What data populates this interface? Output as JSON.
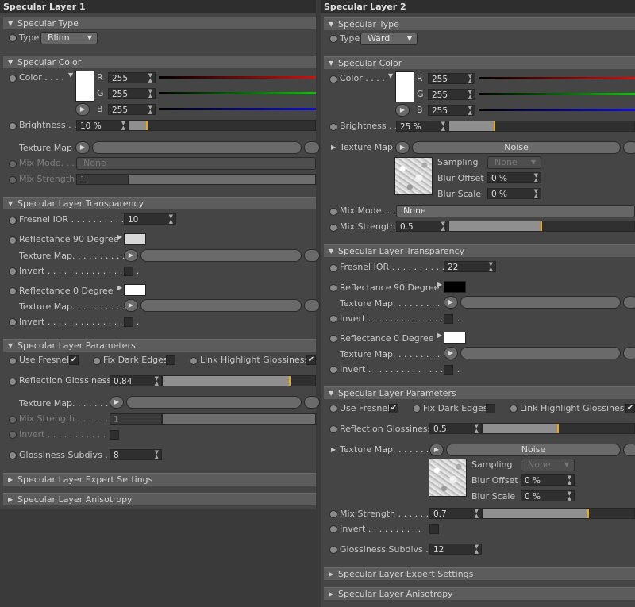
{
  "layer1": {
    "title": "Specular Layer 1",
    "spec_type": {
      "header": "Specular Type",
      "type_label": "Type",
      "type_value": "Blinn"
    },
    "spec_color": {
      "header": "Specular Color",
      "color_label": "Color . . . .",
      "r_label": "R",
      "r_value": "255",
      "g_label": "G",
      "g_value": "255",
      "b_label": "B",
      "b_value": "255",
      "brightness_label": "Brightness . .",
      "brightness_value": "10 %",
      "brightness_fraction": 0.1,
      "texture_label": "Texture Map",
      "mix_mode_label": "Mix Mode. . . .",
      "mix_mode_value": "None",
      "mix_strength_label": "Mix Strength",
      "mix_strength_value": "1",
      "mix_strength_fraction": 1.0
    },
    "transparency": {
      "header": "Specular Layer Transparency",
      "fresnel_label": "Fresnel IOR . . . . . . . . . . . .",
      "fresnel_value": "10",
      "refl90_label": "Reflectance 90 Degree",
      "texture_label": "Texture Map. . . . . . . . . . .",
      "invert_label": "Invert . . . . . . . . . . . . . . . . .",
      "refl0_label": "Reflectance  0 Degree",
      "texture2_label": "Texture Map. . . . . . . . . . .",
      "invert2_label": "Invert . . . . . . . . . . . . . . . . ."
    },
    "params": {
      "header": "Specular Layer Parameters",
      "use_fresnel_label": "Use Fresnel",
      "fix_dark_label": "Fix Dark Edges",
      "link_label": "Link Highlight Glossiness",
      "refl_gloss_label": "Reflection Glossiness",
      "refl_gloss_value": "0.84",
      "refl_gloss_fraction": 0.84,
      "texture_label": "Texture Map. . . . . . . .",
      "mix_strength_label": "Mix Strength . . . . . . .",
      "mix_strength_value": "1",
      "mix_strength_fraction": 1.0,
      "invert_label": "Invert . . . . . . . . . . . . .",
      "subdivs_label": "Glossiness Subdivs . .",
      "subdivs_value": "8"
    },
    "expert": "Specular Layer Expert Settings",
    "aniso": "Specular Layer Anisotropy"
  },
  "layer2": {
    "title": "Specular Layer 2",
    "spec_type": {
      "header": "Specular Type",
      "type_label": "Type",
      "type_value": "Ward"
    },
    "spec_color": {
      "header": "Specular Color",
      "color_label": "Color . . . .",
      "r_label": "R",
      "r_value": "255",
      "g_label": "G",
      "g_value": "255",
      "b_label": "B",
      "b_value": "255",
      "brightness_label": "Brightness . .",
      "brightness_value": "25 %",
      "brightness_fraction": 0.25,
      "texture_label": "Texture Map",
      "texture_shader": "Noise",
      "sampling_label": "Sampling",
      "sampling_value": "None",
      "blur_offset_label": "Blur Offset",
      "blur_offset_value": "0 %",
      "blur_scale_label": "Blur Scale",
      "blur_scale_value": "0 %",
      "mix_mode_label": "Mix Mode. . . .",
      "mix_mode_value": "None",
      "mix_strength_label": "Mix Strength",
      "mix_strength_value": "0.5",
      "mix_strength_fraction": 0.5
    },
    "transparency": {
      "header": "Specular Layer Transparency",
      "fresnel_label": "Fresnel IOR . . . . . . . . . . . .",
      "fresnel_value": "22",
      "refl90_label": "Reflectance 90 Degree",
      "texture_label": "Texture Map. . . . . . . . . . .",
      "invert_label": "Invert . . . . . . . . . . . . . . . . .",
      "refl0_label": "Reflectance  0 Degree",
      "texture2_label": "Texture Map. . . . . . . . . . .",
      "invert2_label": "Invert . . . . . . . . . . . . . . . . ."
    },
    "params": {
      "header": "Specular Layer Parameters",
      "use_fresnel_label": "Use Fresnel",
      "fix_dark_label": "Fix Dark Edges",
      "link_label": "Link Highlight Glossiness",
      "refl_gloss_label": "Reflection Glossiness",
      "refl_gloss_value": "0.5",
      "refl_gloss_fraction": 0.5,
      "texture_label": "Texture Map. . . . . . . .",
      "texture_shader": "Noise",
      "sampling_label": "Sampling",
      "sampling_value": "None",
      "blur_offset_label": "Blur Offset",
      "blur_offset_value": "0 %",
      "blur_scale_label": "Blur Scale",
      "blur_scale_value": "0 %",
      "mix_strength_label": "Mix Strength . . . . . . .",
      "mix_strength_value": "0.7",
      "mix_strength_fraction": 0.7,
      "invert_label": "Invert . . . . . . . . . . . . .",
      "subdivs_label": "Glossiness Subdivs . .",
      "subdivs_value": "12"
    },
    "expert": "Specular Layer Expert Settings",
    "aniso": "Specular Layer Anisotropy"
  },
  "colors": {
    "accent_marker": "#e8a51e",
    "red": "#d01010",
    "green": "#10c010",
    "blue": "#1010d0"
  }
}
